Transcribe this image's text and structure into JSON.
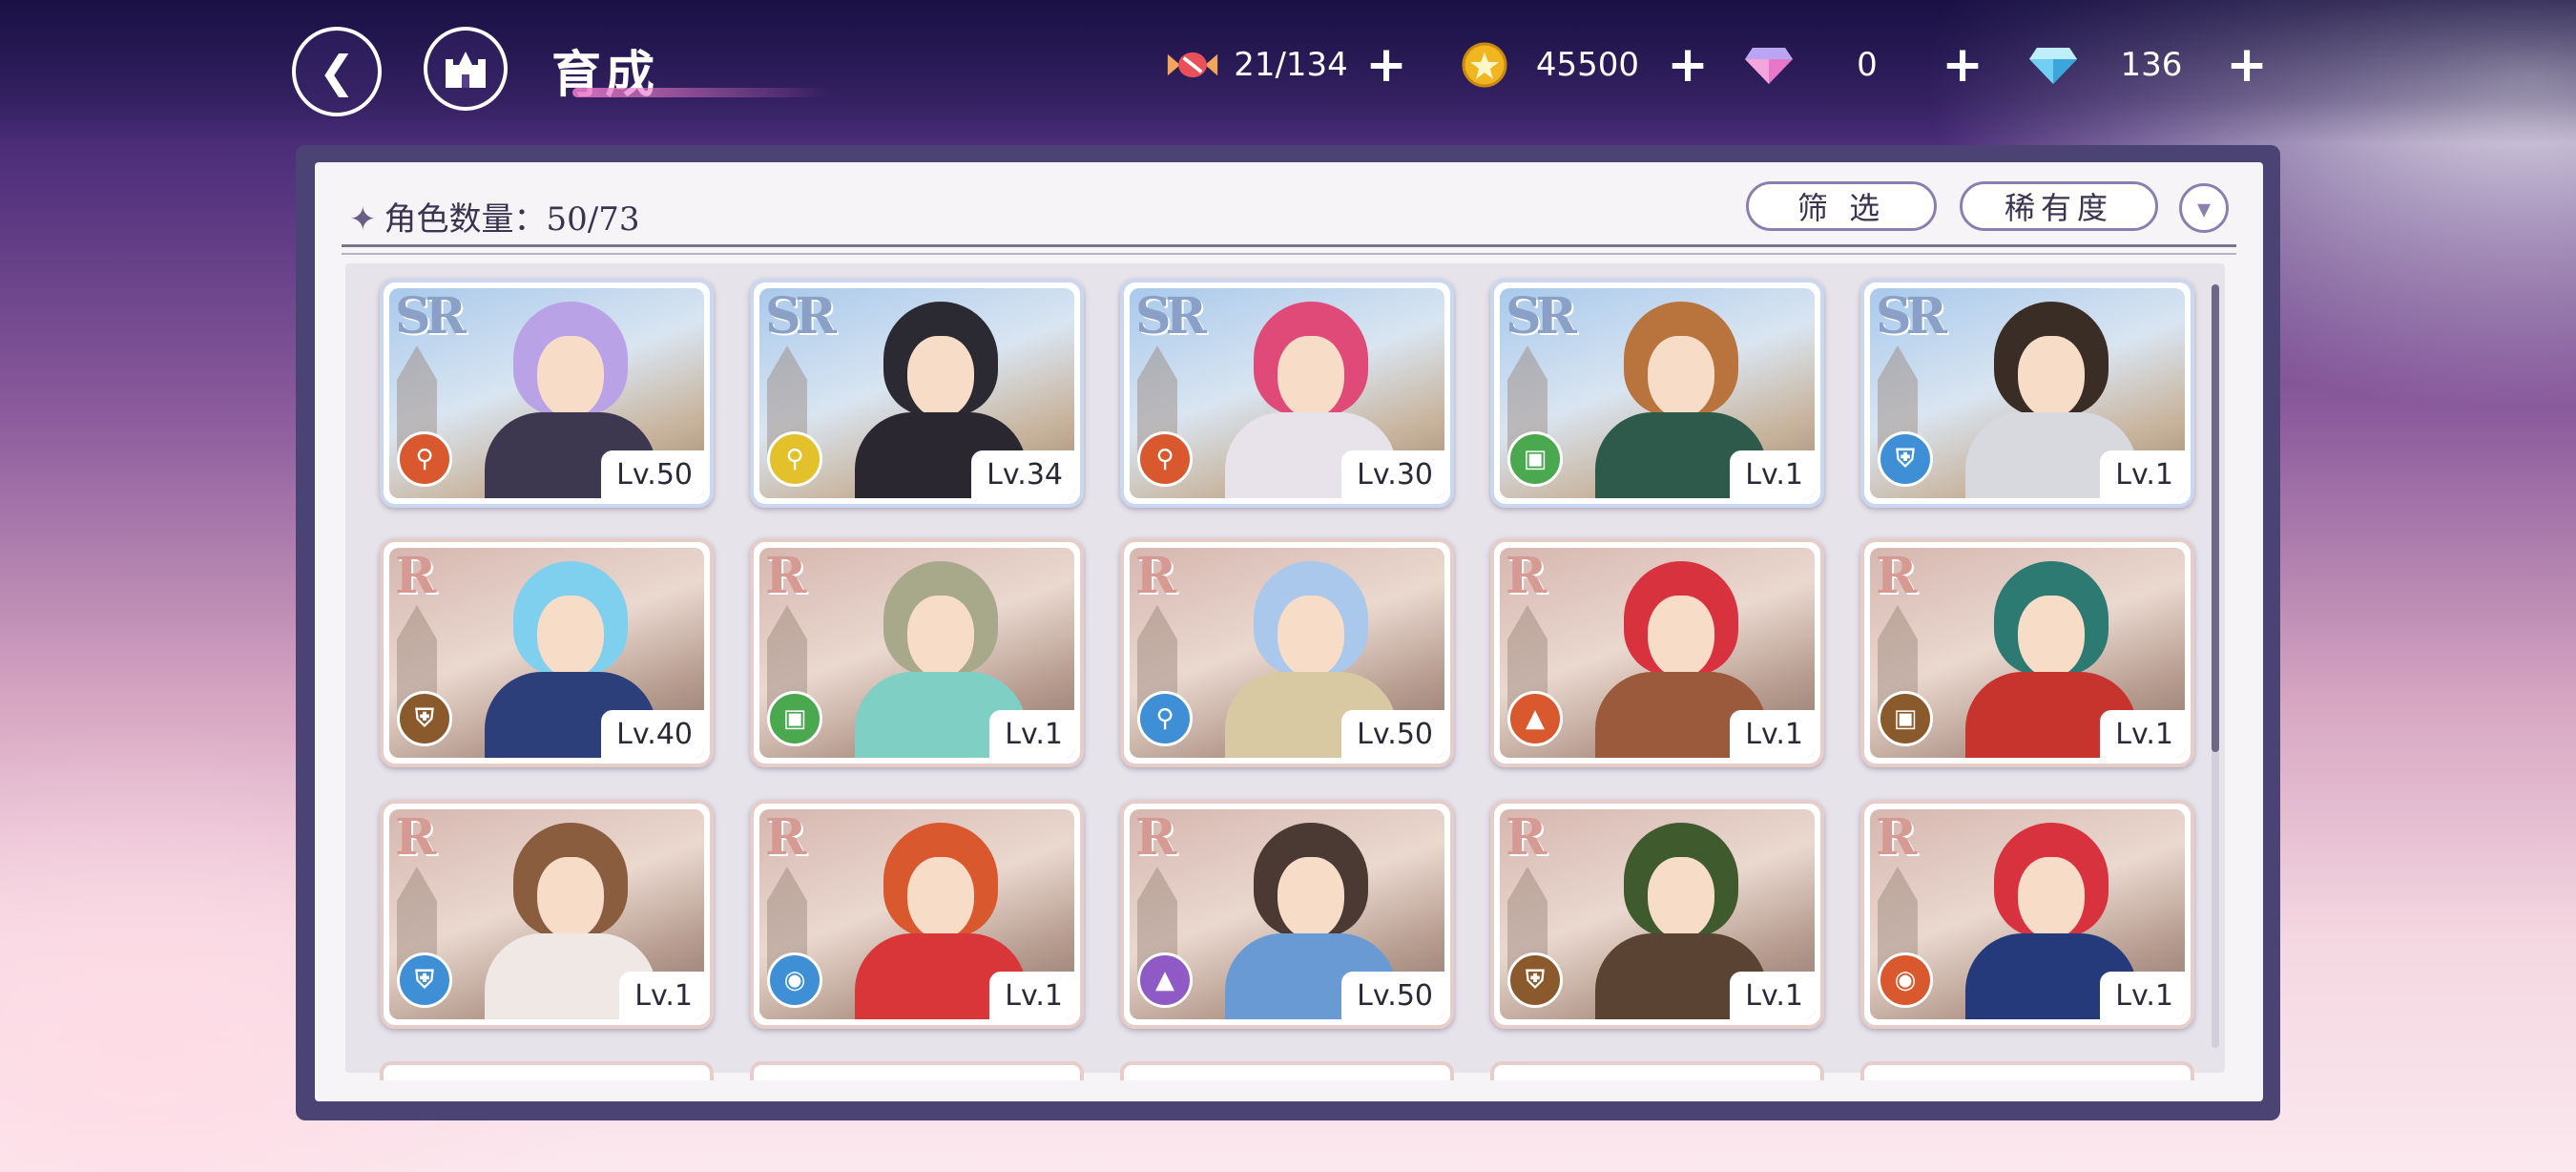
{
  "header": {
    "title": "育成",
    "currencies": [
      {
        "icon": "candy-icon",
        "value": "21/134"
      },
      {
        "icon": "gold-coin-icon",
        "value": "45500"
      },
      {
        "icon": "pink-gem-icon",
        "value": "0"
      },
      {
        "icon": "blue-diamond-icon",
        "value": "136"
      }
    ]
  },
  "panel": {
    "count_label": "角色数量：50/73",
    "filter_label": "筛 选",
    "rarity_label": "稀有度"
  },
  "cards": [
    {
      "rarity": "SR",
      "level": "Lv.50",
      "role_color": "#d9582d",
      "role_icon": "staff-icon",
      "hair": "#b9a3e6",
      "body": "#3d3850"
    },
    {
      "rarity": "SR",
      "level": "Lv.34",
      "role_color": "#e2c12a",
      "role_icon": "staff-icon",
      "hair": "#2b2a33",
      "body": "#2a2730"
    },
    {
      "rarity": "SR",
      "level": "Lv.30",
      "role_color": "#d9582d",
      "role_icon": "staff-icon",
      "hair": "#e04a78",
      "body": "#e8e3ea"
    },
    {
      "rarity": "SR",
      "level": "Lv.1",
      "role_color": "#4aa84f",
      "role_icon": "book-icon",
      "hair": "#b8743c",
      "body": "#2d5a4a"
    },
    {
      "rarity": "SR",
      "level": "Lv.1",
      "role_color": "#3f8fd6",
      "role_icon": "shield-icon",
      "hair": "#3a2d26",
      "body": "#d7d9df"
    },
    {
      "rarity": "R",
      "level": "Lv.40",
      "role_color": "#8a5a2c",
      "role_icon": "shield-icon",
      "hair": "#7fd0ef",
      "body": "#2c3f7a"
    },
    {
      "rarity": "R",
      "level": "Lv.1",
      "role_color": "#4aa84f",
      "role_icon": "book-icon",
      "hair": "#a8a88a",
      "body": "#7fcfc4"
    },
    {
      "rarity": "R",
      "level": "Lv.50",
      "role_color": "#3f8fd6",
      "role_icon": "staff-icon",
      "hair": "#a9c8ec",
      "body": "#d9c9a3"
    },
    {
      "rarity": "R",
      "level": "Lv.1",
      "role_color": "#d9582d",
      "role_icon": "boot-icon",
      "hair": "#d9323f",
      "body": "#9b5a3c"
    },
    {
      "rarity": "R",
      "level": "Lv.1",
      "role_color": "#8a5a2c",
      "role_icon": "book-icon",
      "hair": "#2d7a72",
      "body": "#c7332d"
    },
    {
      "rarity": "R",
      "level": "Lv.1",
      "role_color": "#3f8fd6",
      "role_icon": "shield-icon",
      "hair": "#8a5d3f",
      "body": "#f0e8e4"
    },
    {
      "rarity": "R",
      "level": "Lv.1",
      "role_color": "#3f8fd6",
      "role_icon": "fist-icon",
      "hair": "#d9582d",
      "body": "#d9363a"
    },
    {
      "rarity": "R",
      "level": "Lv.50",
      "role_color": "#8f5ac6",
      "role_icon": "boot-icon",
      "hair": "#4b3a33",
      "body": "#6a9ad4"
    },
    {
      "rarity": "R",
      "level": "Lv.1",
      "role_color": "#8a5a2c",
      "role_icon": "shield-icon",
      "hair": "#3f5a2c",
      "body": "#5a4332"
    },
    {
      "rarity": "R",
      "level": "Lv.1",
      "role_color": "#d9582d",
      "role_icon": "fist-icon",
      "hair": "#d9323f",
      "body": "#243a7a"
    }
  ]
}
